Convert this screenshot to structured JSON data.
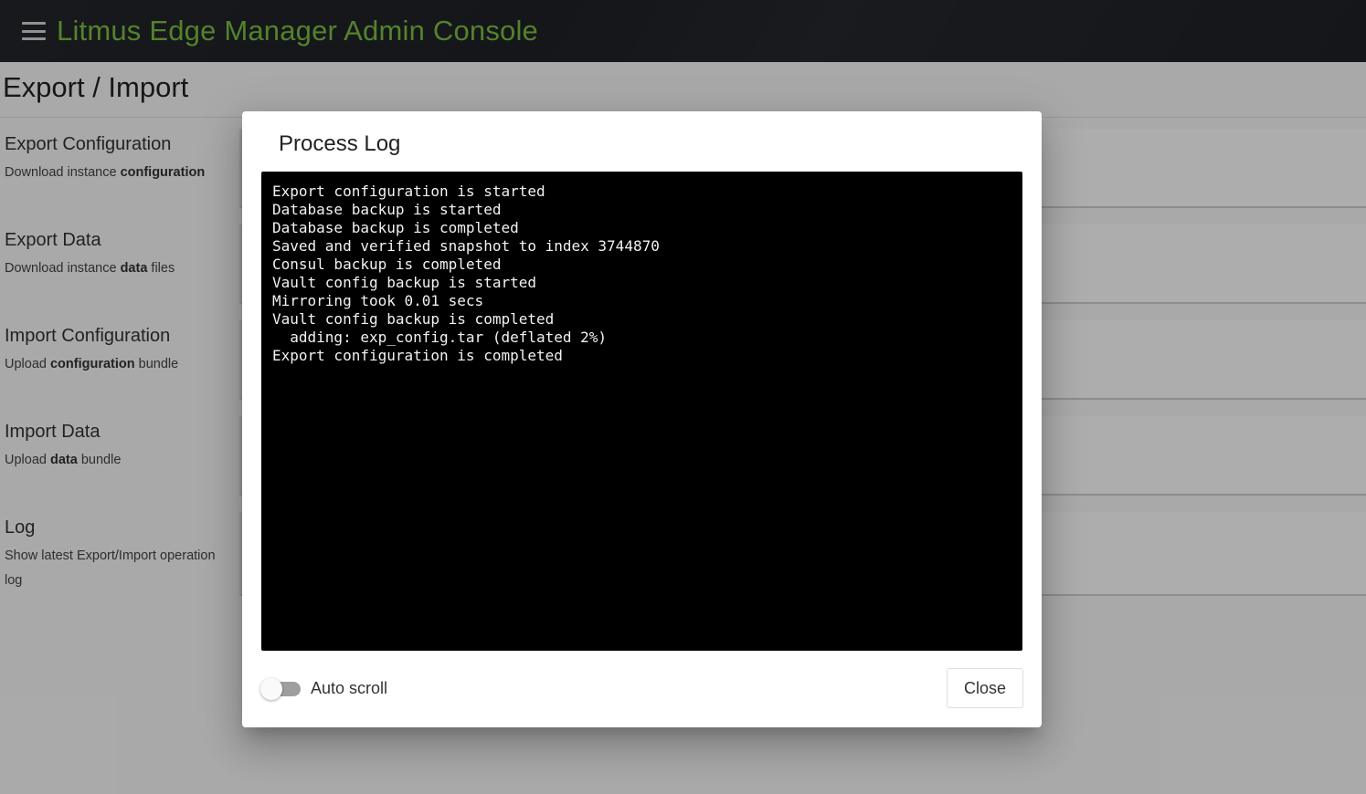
{
  "app": {
    "title": "Litmus Edge Manager Admin Console",
    "accent_color": "#7bc042",
    "menu_icon": "hamburger-menu-icon"
  },
  "page": {
    "title": "Export / Import"
  },
  "sections": [
    {
      "title": "Export Configuration",
      "desc_pre": "Download instance ",
      "desc_bold": "configuration",
      "desc_post": ""
    },
    {
      "title": "Export Data",
      "desc_pre": "Download instance ",
      "desc_bold": "data",
      "desc_post": " files"
    },
    {
      "title": "Import Configuration",
      "desc_pre": "Upload ",
      "desc_bold": "configuration",
      "desc_post": " bundle"
    },
    {
      "title": "Import Data",
      "desc_pre": "Upload ",
      "desc_bold": "data",
      "desc_post": " bundle"
    },
    {
      "title": "Log",
      "desc_pre": "Show latest Export/Import operation log",
      "desc_bold": "",
      "desc_post": ""
    }
  ],
  "dialog": {
    "title": "Process Log",
    "log_lines": [
      "Export configuration is started",
      "Database backup is started",
      "Database backup is completed",
      "Saved and verified snapshot to index 3744870",
      "Consul backup is completed",
      "Vault config backup is started",
      "Mirroring took 0.01 secs",
      "Vault config backup is completed",
      "  adding: exp_config.tar (deflated 2%)",
      "Export configuration is completed"
    ],
    "auto_scroll_label": "Auto scroll",
    "auto_scroll_on": false,
    "close_label": "Close"
  }
}
